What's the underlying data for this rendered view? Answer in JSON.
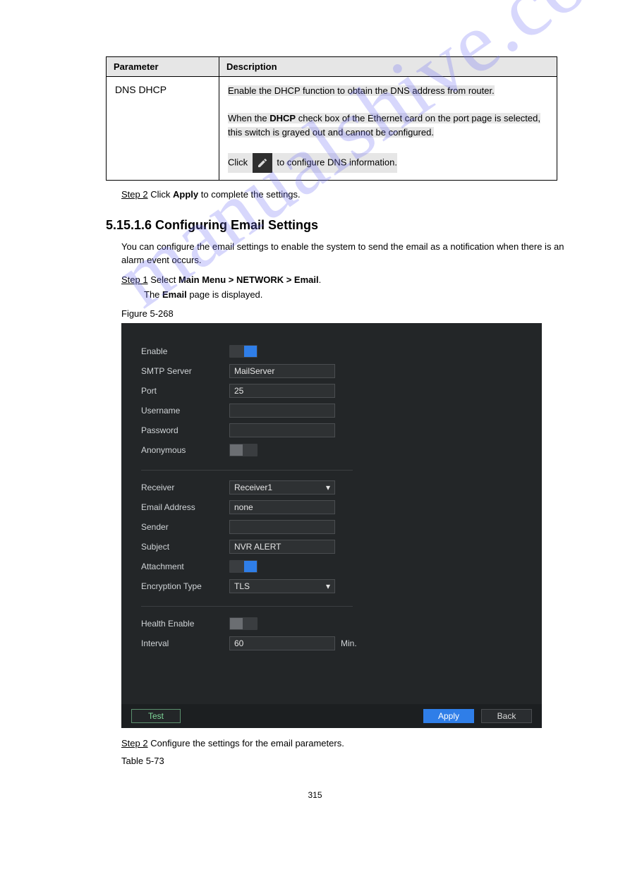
{
  "table": {
    "head_param": "Parameter",
    "head_desc": "Description",
    "row_label": "DNS DHCP",
    "desc_line1": "Enable the DHCP function to obtain the DNS address from router.",
    "desc_line2_a": "When the ",
    "desc_line2_b": "DHCP",
    "desc_line2_c": " check box of the Ethernet card on the port page is selected, this switch is grayed out and cannot be configured.",
    "desc_line3_a": "Click ",
    "desc_line3_b": " to configure DNS information."
  },
  "step_apply_a": "Step 2",
  "step_apply_b": "Click ",
  "step_apply_c": "Apply",
  "step_apply_d": " to complete the settings.",
  "section_heading": "5.15.1.6 Configuring Email Settings",
  "intro": "You can configure the email settings to enable the system to send the email as a notification when there is an alarm event occurs.",
  "step_select_a": "Step 1",
  "step_select_b": "Select ",
  "step_select_c": "Main Menu > NETWORK > Email",
  "step_select_d": ".",
  "the_page_a": "The ",
  "the_page_b": "Email",
  "the_page_c": " page is displayed.",
  "fig_caption": "Figure 5-268",
  "shot": {
    "enable": "Enable",
    "smtp": "SMTP Server",
    "smtp_val": "MailServer",
    "port": "Port",
    "port_val": "25",
    "user": "Username",
    "user_val": "",
    "pass": "Password",
    "pass_val": "",
    "anon": "Anonymous",
    "recv": "Receiver",
    "recv_val": "Receiver1",
    "email": "Email Address",
    "email_val": "none",
    "sender": "Sender",
    "sender_val": "",
    "subject": "Subject",
    "subject_val": "NVR ALERT",
    "attach": "Attachment",
    "enc": "Encryption Type",
    "enc_val": "TLS",
    "health": "Health Enable",
    "interval": "Interval",
    "interval_val": "60",
    "min": "Min.",
    "test": "Test",
    "apply": "Apply",
    "back": "Back"
  },
  "step_cfg_a": "Step 2",
  "step_cfg_b": "Configure the settings for the email parameters.",
  "tbl_caption": "Table 5-73",
  "pageno": "315",
  "watermark": "manualshive.com"
}
